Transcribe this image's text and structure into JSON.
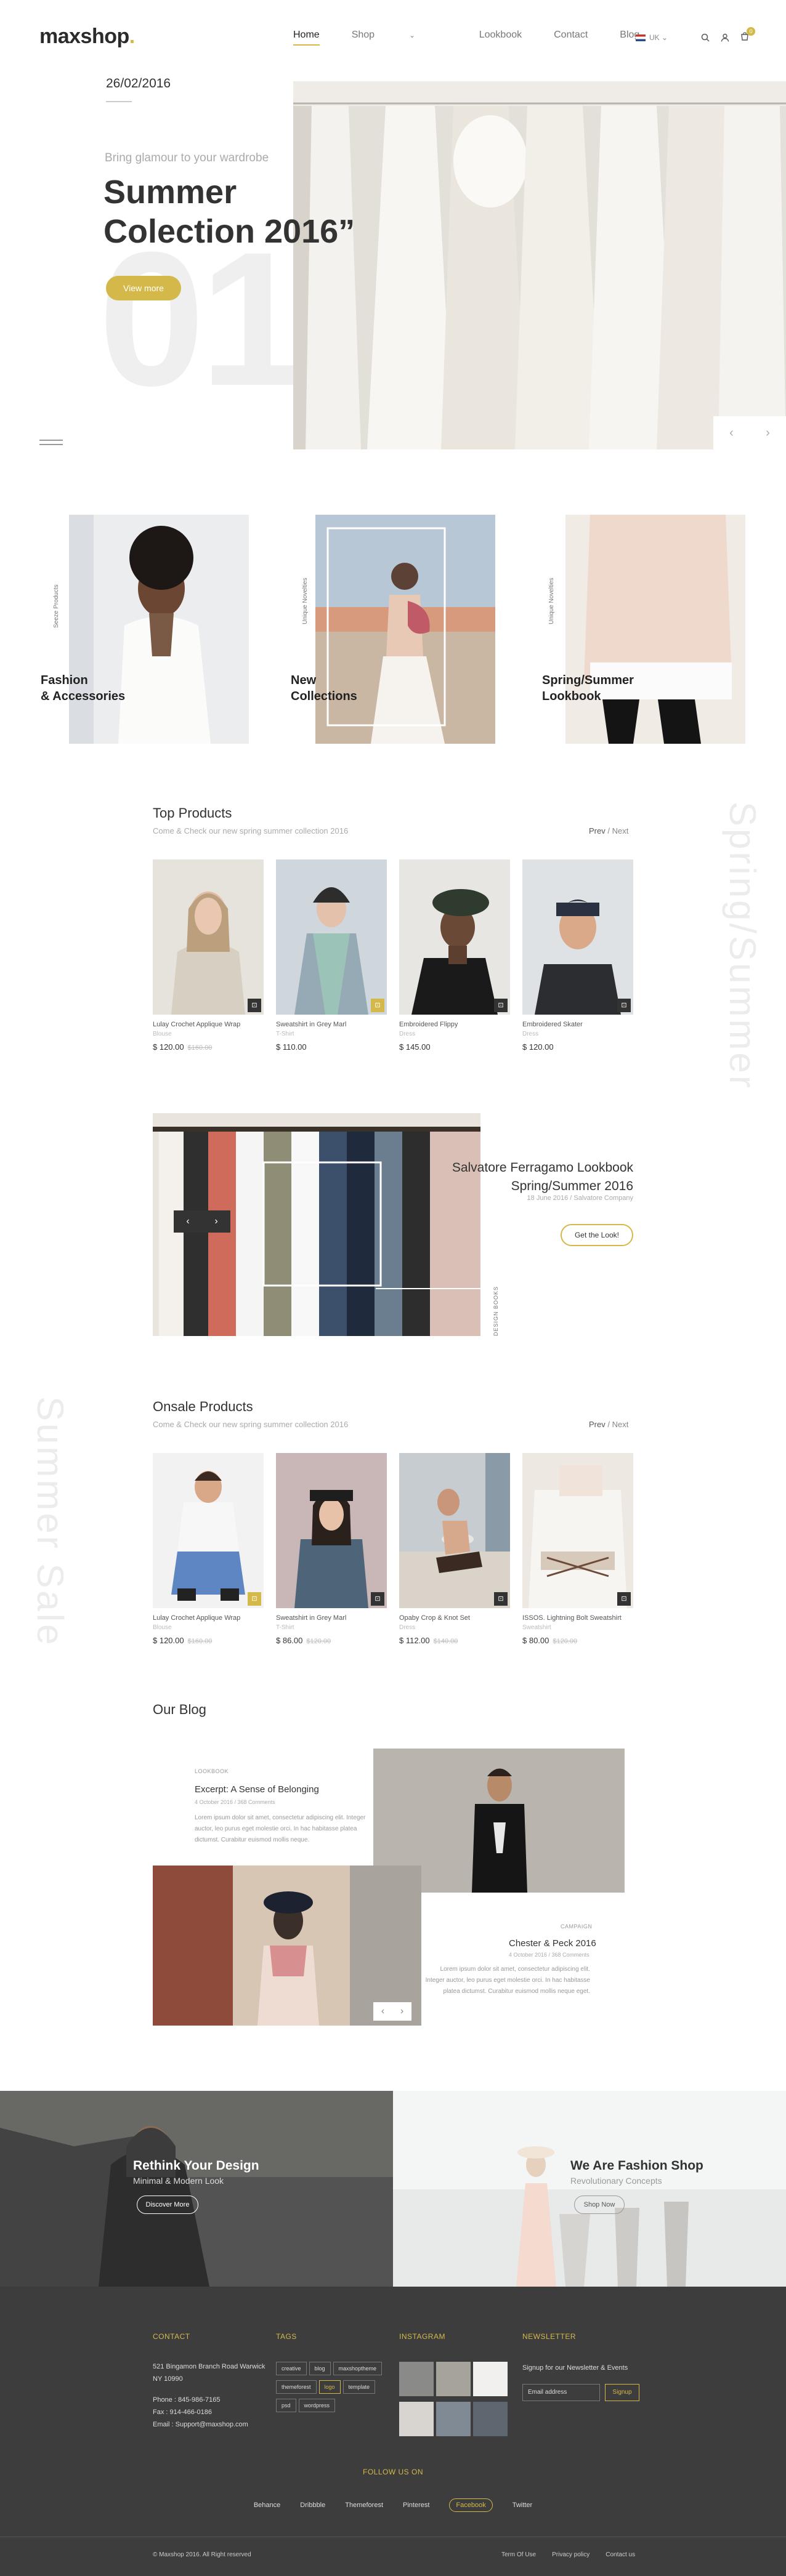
{
  "header": {
    "logo_main": "maxshop",
    "logo_dot": ".",
    "nav": [
      "Home",
      "Shop",
      "Lookbook",
      "Contact",
      "Blog"
    ],
    "shop_caret": "⌄",
    "lang": "UK",
    "cart_count": "0"
  },
  "hero": {
    "date": "26/02/2016",
    "subtitle": "Bring glamour to your wardrobe",
    "title_line1": "Summer",
    "title_line2": "Colection 2016”",
    "big_number": "01",
    "button": "View more",
    "prev": "‹",
    "next": "›"
  },
  "categories": [
    {
      "label_line1": "Fashion",
      "label_line2": "& Accessories",
      "vertical": "Seeze Products"
    },
    {
      "label_line1": "New",
      "label_line2": "Collections",
      "vertical": "Unique Novelties"
    },
    {
      "label_line1": "Spring/Summer",
      "label_line2": "Lookbook",
      "vertical": "Unique Novelties"
    }
  ],
  "top_products": {
    "title": "Top Products",
    "subtitle": "Come & Check our new spring summer collection 2016",
    "prev": "Prev",
    "sep": "/",
    "next": "Next",
    "side_text": "Spring/Summer",
    "items": [
      {
        "name": "Lulay Crochet Applique Wrap",
        "cat": "Blouse",
        "price": "$ 120.00",
        "old": "$160.00"
      },
      {
        "name": "Sweatshirt in Grey Marl",
        "cat": "T-Shirt",
        "price": "$ 110.00",
        "old": ""
      },
      {
        "name": "Embroidered Flippy",
        "cat": "Dress",
        "price": "$ 145.00",
        "old": ""
      },
      {
        "name": "Embroidered Skater",
        "cat": "Dress",
        "price": "$ 120.00",
        "old": ""
      }
    ]
  },
  "lookbook": {
    "title_line1": "Salvatore Ferragamo Lookbook",
    "title_line2": "Spring/Summer 2016",
    "meta": "18 June 2016 / Salvatore Company",
    "button": "Get the Look!",
    "vertical": "DESIGN BOOKS",
    "prev": "‹",
    "next": "›"
  },
  "onsale_products": {
    "title": "Onsale Products",
    "subtitle": "Come & Check our new spring summer collection 2016",
    "prev": "Prev",
    "sep": "/",
    "next": "Next",
    "side_text": "Summer Sale",
    "items": [
      {
        "name": "Lulay Crochet Applique Wrap",
        "cat": "Blouse",
        "price": "$ 120.00",
        "old": "$160.00"
      },
      {
        "name": "Sweatshirt in Grey Marl",
        "cat": "T-Shirt",
        "price": "$ 86.00",
        "old": "$120.00"
      },
      {
        "name": "Opaby Crop & Knot Set",
        "cat": "Dress",
        "price": "$ 112.00",
        "old": "$140.00"
      },
      {
        "name": "ISSOS. Lightning Bolt Sweatshirt",
        "cat": "Sweatshirt",
        "price": "$ 80.00",
        "old": "$120.00"
      }
    ]
  },
  "blog": {
    "title": "Our Blog",
    "post1": {
      "cat": "LOOKBOOK",
      "title": "Excerpt: A Sense of Belonging",
      "date": "4 October 2016 / 368 Comments",
      "text": "Lorem ipsum dolor sit amet, consectetur adipiscing elit. Integer auctor, leo purus eget molestie orci. In hac habitasse platea dictumst. Curabitur euismod mollis neque."
    },
    "post2": {
      "cat": "CAMPAIGN",
      "title": "Chester & Peck 2016",
      "date": "4 October 2016 / 368 Comments",
      "text": "Lorem ipsum dolor sit amet, consectetur adipiscing elit. Integer auctor, leo purus eget molestie orci. In hac habitasse platea dictumst. Curabitur euismod mollis neque eget."
    },
    "prev": "‹",
    "next": "›"
  },
  "promo": {
    "left": {
      "title": "Rethink Your Design",
      "sub": "Minimal & Modern Look",
      "button": "Discover More"
    },
    "right": {
      "title": "We Are Fashion Shop",
      "sub": "Revolutionary Concepts",
      "button": "Shop Now"
    }
  },
  "footer": {
    "contact_h": "CONTACT",
    "address1": "521 Bingamon Branch Road Warwick",
    "address2": "NY 10990",
    "phone": "Phone : 845-986-7165",
    "fax": "Fax : 914-466-0186",
    "email": "Email : Support@maxshop.com",
    "tags_h": "TAGS",
    "tags": [
      "creative",
      "blog",
      "maxshoptheme",
      "themeforest",
      "logo",
      "template",
      "psd",
      "wordpress"
    ],
    "insta_h": "INSTAGRAM",
    "news_h": "NEWSLETTER",
    "news_text": "Signup for our Newsletter & Events",
    "email_placeholder": "Email address",
    "signup": "Signup",
    "follow_h": "FOLLOW US ON",
    "social": [
      "Behance",
      "Dribbble",
      "Themeforest",
      "Pinterest",
      "Facebook",
      "Twitter"
    ],
    "copyright": "© Maxshop 2016. All Right reserved",
    "links": [
      "Term Of Use",
      "Privacy policy",
      "Contact us"
    ]
  },
  "colors": {
    "accent": "#d4b94a",
    "dark": "#3d3d3d"
  }
}
